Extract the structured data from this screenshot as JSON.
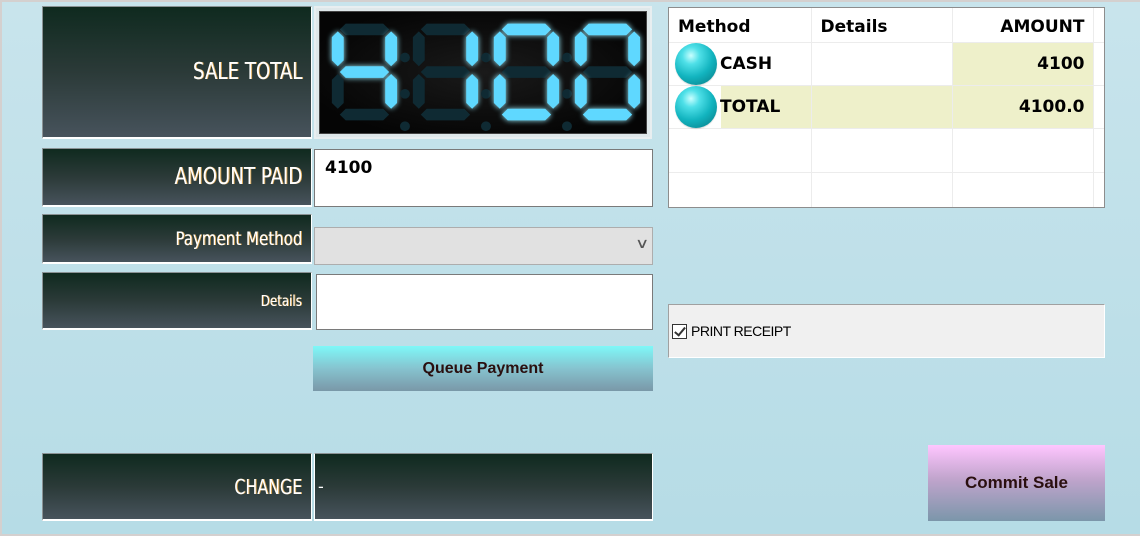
{
  "labels": {
    "sale_total": "SALE TOTAL",
    "amount_paid": "AMOUNT PAID",
    "payment_method": "Payment Method",
    "details": "Details",
    "change": "CHANGE"
  },
  "sale_total_display": "4100",
  "amount_paid_value": "4100",
  "payment_method_value": "",
  "details_value": "",
  "change_value": "-",
  "buttons": {
    "queue_payment": "Queue Payment",
    "commit_sale": "Commit Sale"
  },
  "payments_grid": {
    "columns": [
      "Method",
      "Details",
      "AMOUNT"
    ],
    "rows": [
      {
        "method": "CASH",
        "details": "",
        "amount": "4100",
        "icon": "cyan-ball-icon"
      },
      {
        "method": "TOTAL",
        "details": "",
        "amount": "4100.0",
        "icon": "cyan-ball-icon"
      }
    ]
  },
  "print_receipt": {
    "label": "PRINT RECEIPT",
    "checked": true
  },
  "colors": {
    "lcd_segment_on": "#5fd8ff",
    "highlight_row": "#eef0ca",
    "label_panel_dark": "#0f2a1f"
  }
}
